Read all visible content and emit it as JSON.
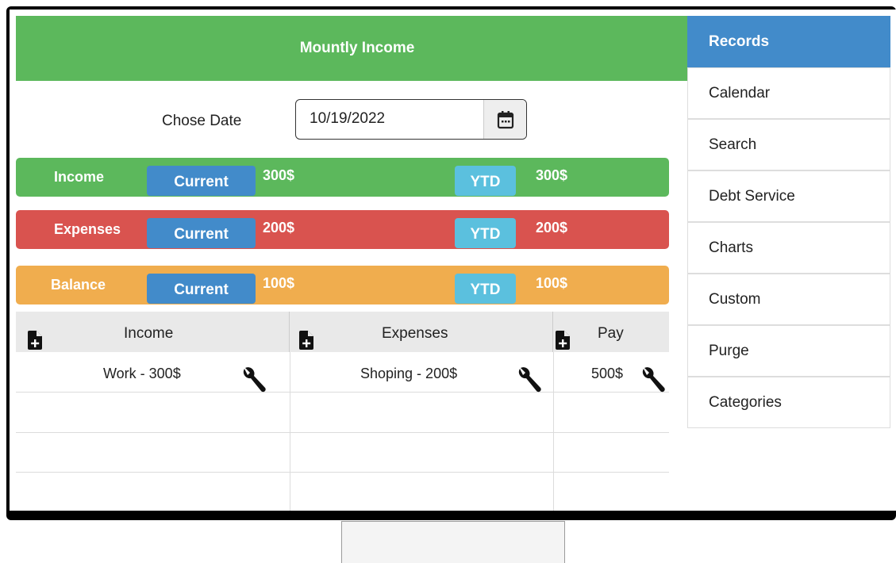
{
  "header": {
    "title": "Mountly Income"
  },
  "date": {
    "label": "Chose Date",
    "value": "10/19/2022"
  },
  "summary": {
    "income": {
      "label": "Income",
      "current_label": "Current",
      "current_value": "300$",
      "ytd_label": "YTD",
      "ytd_value": "300$"
    },
    "expenses": {
      "label": "Expenses",
      "current_label": "Current",
      "current_value": "200$",
      "ytd_label": "YTD",
      "ytd_value": "200$"
    },
    "balance": {
      "label": "Balance",
      "current_label": "Current",
      "current_value": "100$",
      "ytd_label": "YTD",
      "ytd_value": "100$"
    }
  },
  "table": {
    "columns": [
      "Income",
      "Expenses",
      "Pay"
    ],
    "rows": [
      {
        "income": "Work - 300$",
        "expenses": "Shoping - 200$",
        "pay": "500$"
      }
    ]
  },
  "sidebar": {
    "items": [
      {
        "label": "Records"
      },
      {
        "label": "Calendar"
      },
      {
        "label": "Search"
      },
      {
        "label": "Debt Service"
      },
      {
        "label": "Charts"
      },
      {
        "label": "Custom"
      },
      {
        "label": "Purge"
      },
      {
        "label": "Categories"
      }
    ]
  },
  "colors": {
    "income": "#5cb85c",
    "expenses": "#d9534f",
    "balance": "#f0ad4e",
    "current_button": "#428bca",
    "ytd_button": "#5bc0de",
    "sidebar_active": "#428bca"
  },
  "icons": {
    "date_picker": "calendar-icon",
    "add": "file-plus-icon",
    "edit": "wrench-icon"
  }
}
